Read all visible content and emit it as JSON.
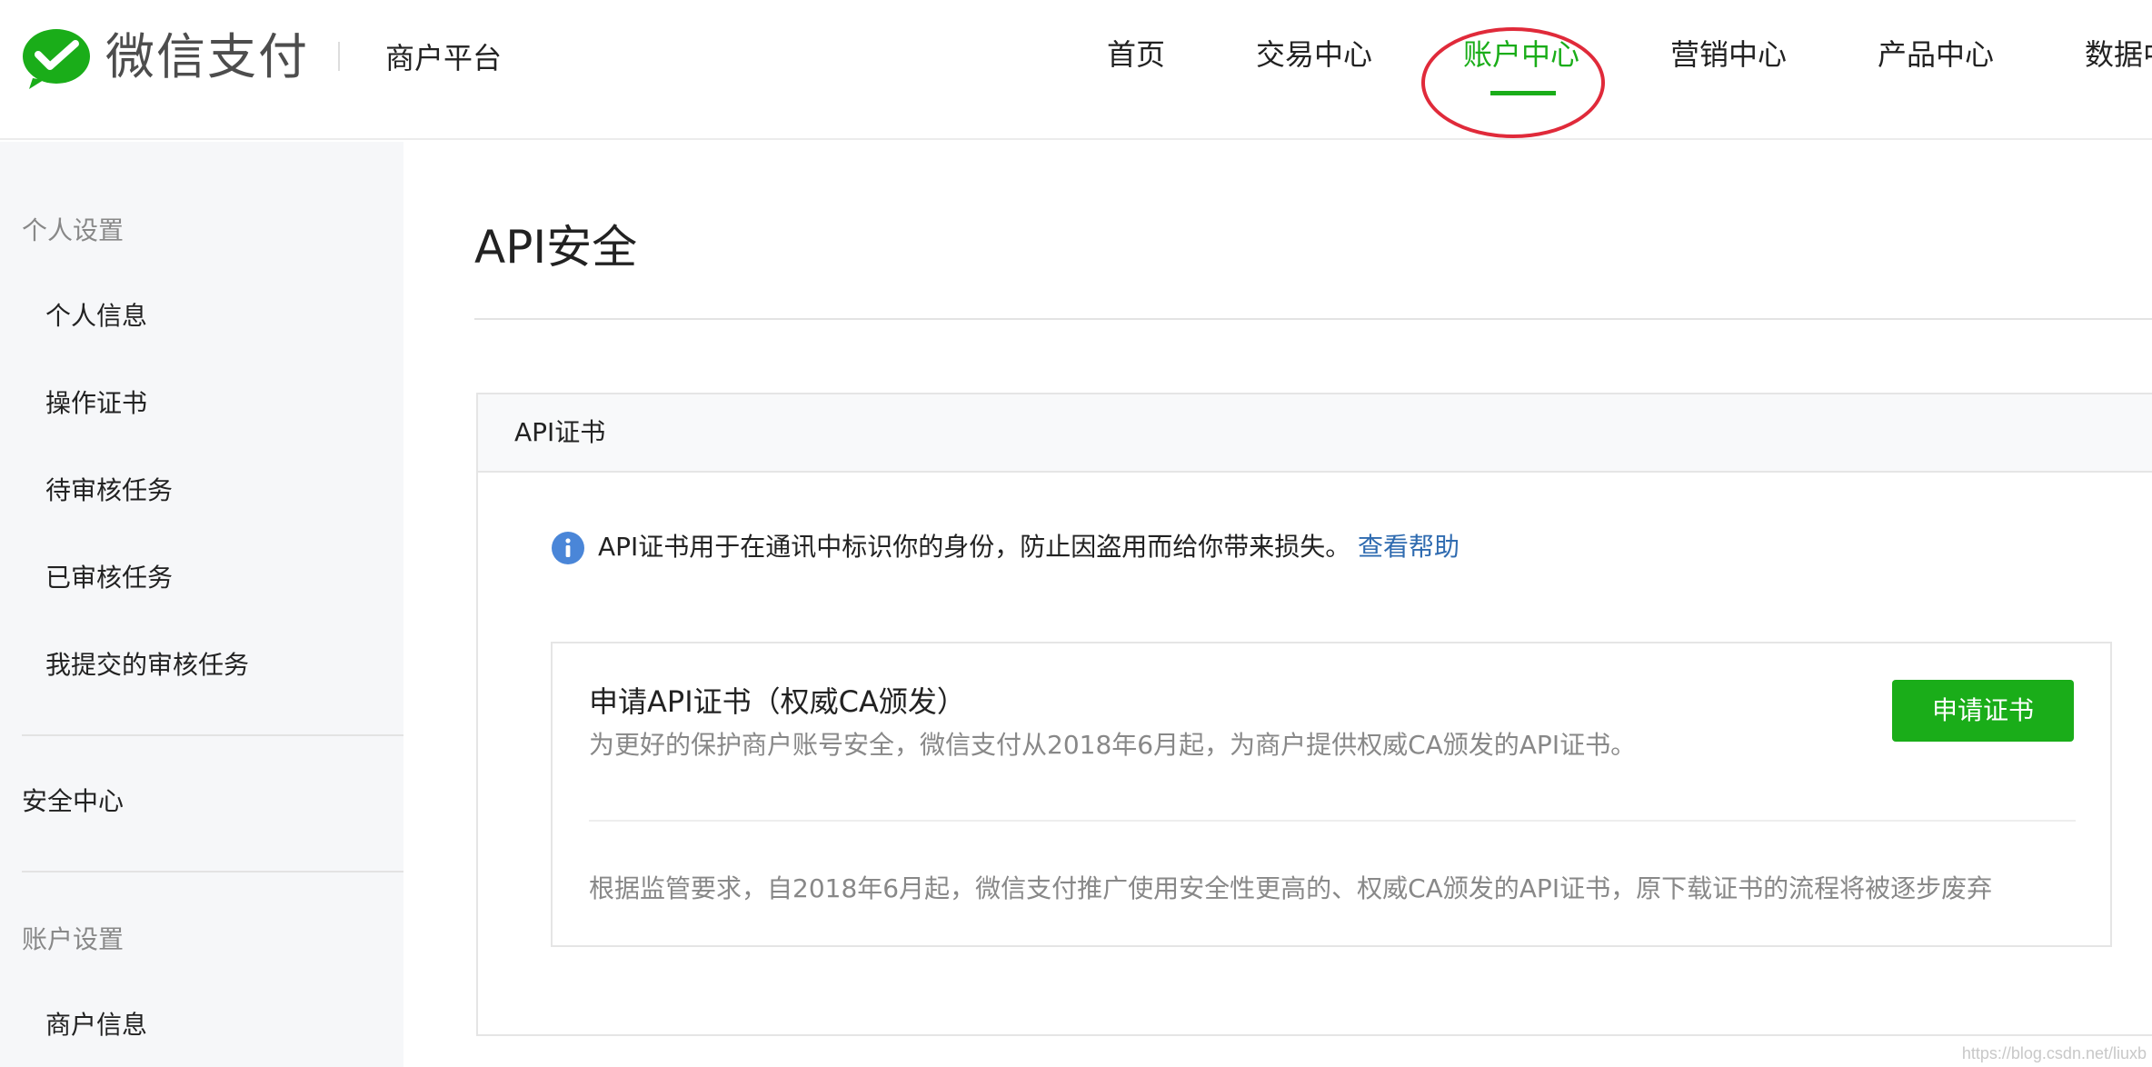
{
  "header": {
    "brand_name": "微信支付",
    "platform_name": "商户平台",
    "nav": [
      {
        "label": "首页"
      },
      {
        "label": "交易中心"
      },
      {
        "label": "账户中心",
        "active": true
      },
      {
        "label": "营销中心"
      },
      {
        "label": "产品中心"
      },
      {
        "label": "数据中"
      }
    ]
  },
  "sidebar": {
    "personal_settings": {
      "group_label": "个人设置",
      "items": [
        {
          "label": "个人信息"
        },
        {
          "label": "操作证书"
        },
        {
          "label": "待审核任务"
        },
        {
          "label": "已审核任务"
        },
        {
          "label": "我提交的审核任务"
        }
      ]
    },
    "security_center": "安全中心",
    "account_settings": {
      "group_label": "账户设置",
      "items": [
        {
          "label": "商户信息"
        }
      ]
    }
  },
  "main": {
    "page_title": "API安全",
    "panel": {
      "title": "API证书",
      "info_text": "API证书用于在通讯中标识你的身份，防止因盗用而给你带来损失。",
      "help_link": "查看帮助",
      "card": {
        "title": "申请API证书（权威CA颁发）",
        "description": "为更好的保护商户账号安全，微信支付从2018年6月起，为商户提供权威CA颁发的API证书。",
        "button_label": "申请证书",
        "note": "根据监管要求，自2018年6月起，微信支付推广使用安全性更高的、权威CA颁发的API证书，原下载证书的流程将被逐步废弃"
      }
    }
  },
  "watermark": "https://blog.csdn.net/liuxb",
  "colors": {
    "brand_green": "#1aad19",
    "link_blue": "#2f6bb0",
    "highlight_red": "#e02a3a",
    "sidebar_bg": "#f6f7f9"
  },
  "icons": {
    "logo": "wechat-pay-logo",
    "info": "info-icon"
  }
}
